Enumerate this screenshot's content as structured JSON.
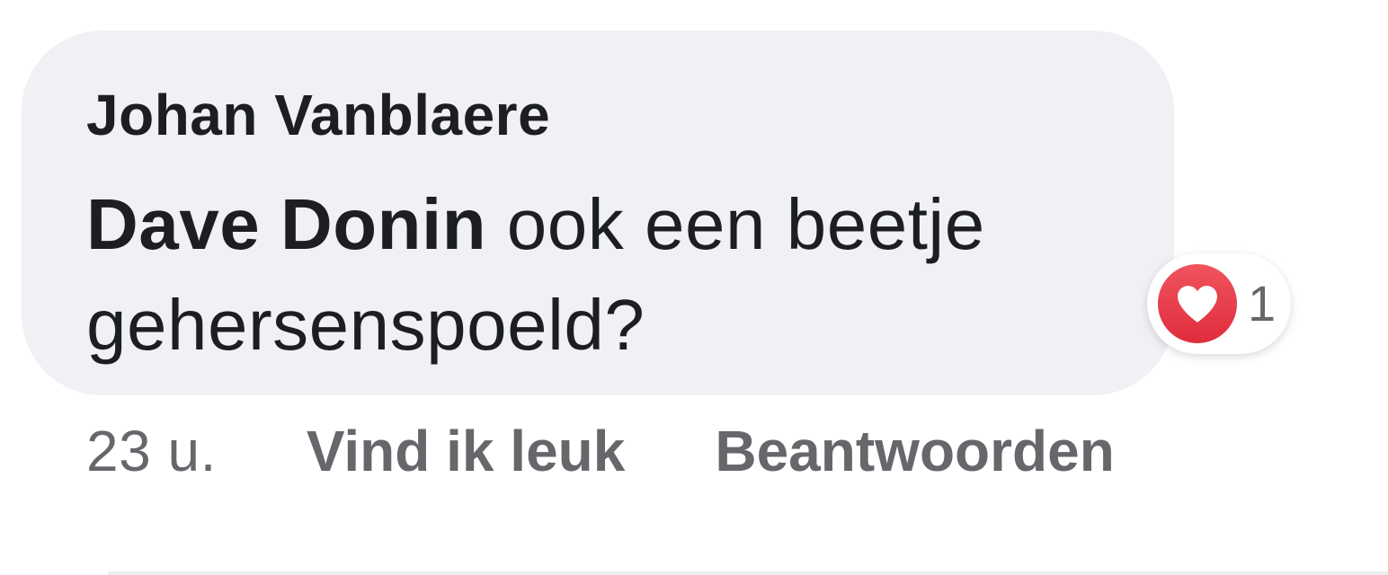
{
  "comment": {
    "author": "Johan Vanblaere",
    "mention": "Dave Donin",
    "text": " ook een beetje gehersenspoeld?"
  },
  "reaction": {
    "icon": "heart-icon",
    "color": "#e4363f",
    "count": "1"
  },
  "actions": {
    "timestamp": "23 u.",
    "like_label": "Vind ik leuk",
    "reply_label": "Beantwoorden"
  },
  "colors": {
    "bubble": "#eff1f4",
    "text": "#1c1e21",
    "secondary": "#65676b"
  }
}
